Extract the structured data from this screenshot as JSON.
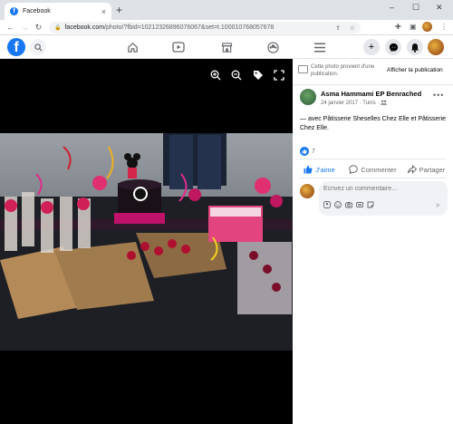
{
  "browser": {
    "tab_title": "Facebook",
    "tab_close": "×",
    "new_tab": "+",
    "url_host": "facebook.com",
    "url_path": "/photo/?fbid=10212326896076067&set=t.100010768057678",
    "window_minimize": "–",
    "window_maximize": "☐",
    "window_close": "✕"
  },
  "header": {
    "logo": "f"
  },
  "photo_notice": {
    "text": "Cette photo provient d'une publication.",
    "link": "Afficher la publication"
  },
  "post": {
    "author": "Asma Hammami EP Benrached",
    "date": "24 janvier 2017 · Tunis ·",
    "caption": "— avec Pâtisserie Sheselles Chez Elle et Pâtisserie Chez Elle.",
    "like_count": "7"
  },
  "actions": {
    "like": "J'aime",
    "comment": "Commenter",
    "share": "Partager"
  },
  "comment": {
    "placeholder": "Écrivez un commentaire…"
  },
  "colors": {
    "facebook_blue": "#1877f2",
    "viewer_bg": "#000000"
  }
}
